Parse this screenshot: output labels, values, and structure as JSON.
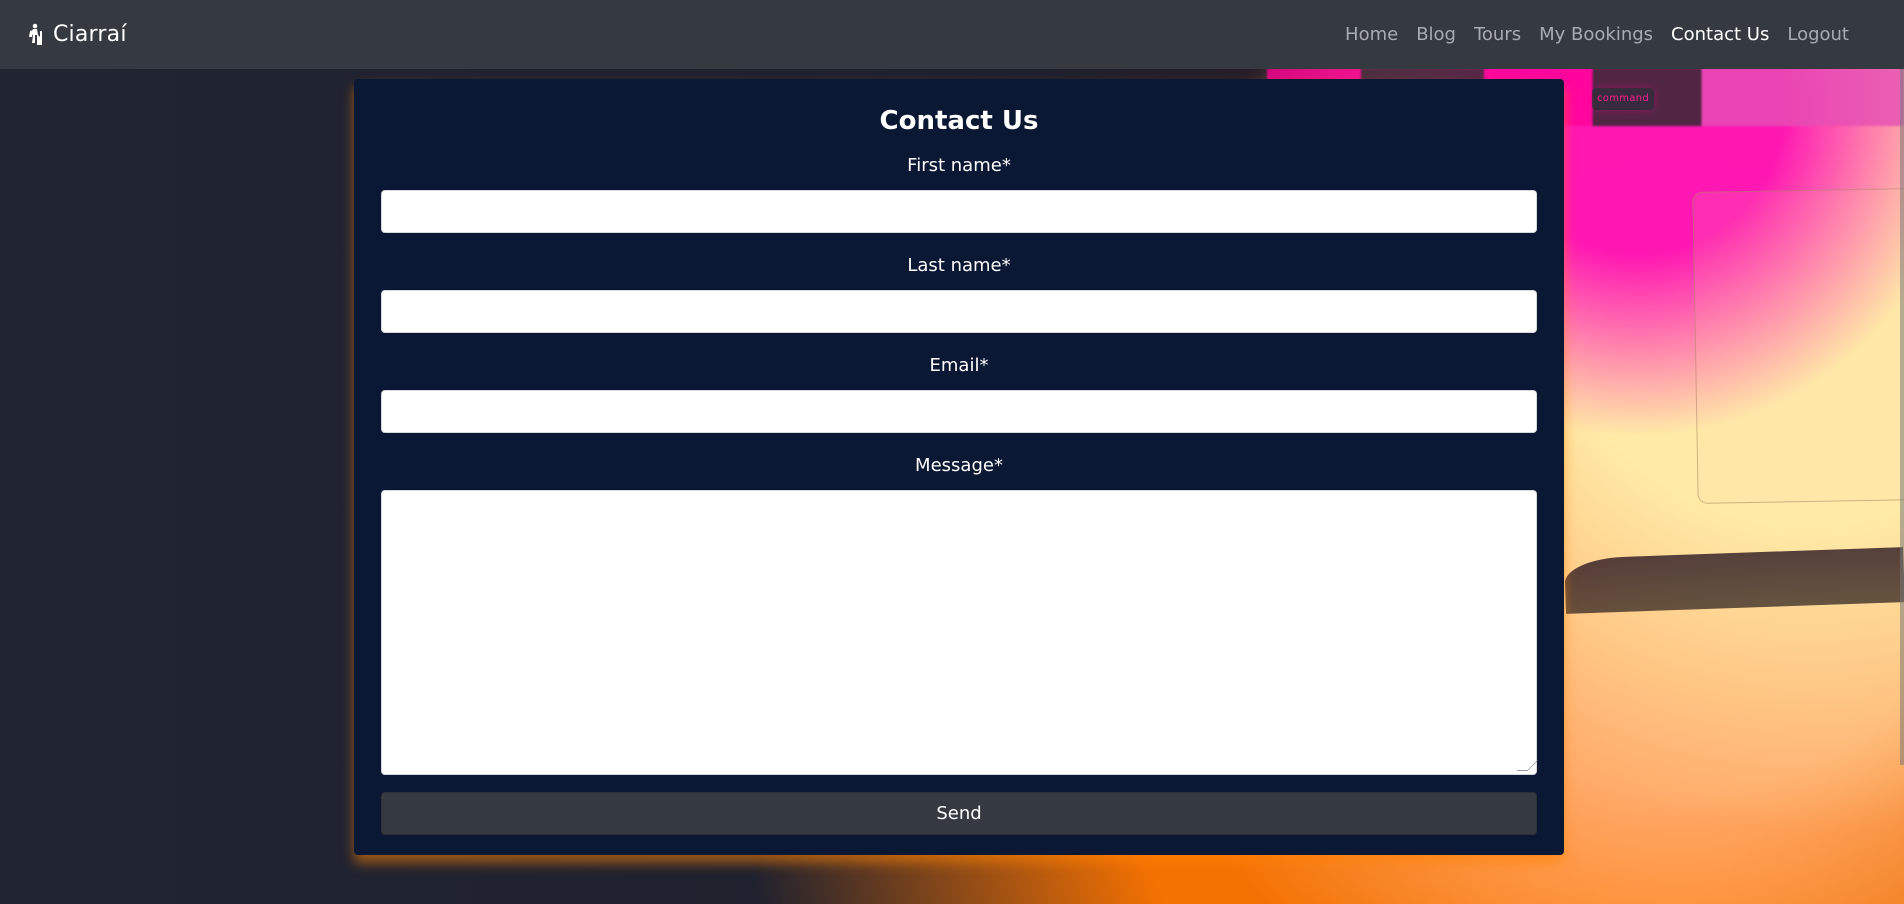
{
  "navbar": {
    "brand": "Ciarraí",
    "brand_icon": "hiking-icon",
    "links": [
      "Home",
      "Blog",
      "Tours",
      "My Bookings",
      "Contact Us",
      "Logout"
    ],
    "active_link": "Contact Us"
  },
  "background": {
    "keyboard_label": "command"
  },
  "contact_form": {
    "title": "Contact Us",
    "fields": [
      {
        "label": "First name*",
        "value": "",
        "placeholder": ""
      },
      {
        "label": "Last name*",
        "value": "",
        "placeholder": ""
      },
      {
        "label": "Email*",
        "value": "",
        "placeholder": ""
      }
    ],
    "message": {
      "label": "Message*",
      "value": "",
      "placeholder": ""
    },
    "send_label": "Send"
  },
  "colors": {
    "navbar_bg": "#343a40",
    "nav_active": "#ffffff",
    "nav_inactive": "#a8acb0",
    "card_bg": "#0b1834",
    "button_bg": "#343a40"
  }
}
